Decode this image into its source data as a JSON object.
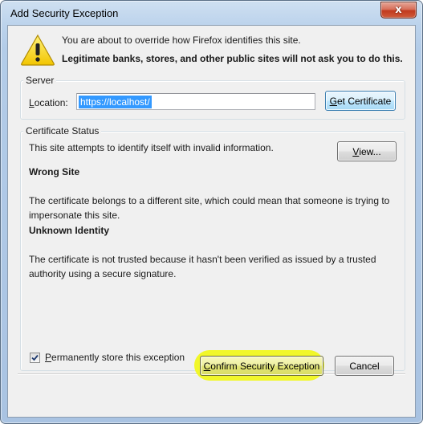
{
  "window": {
    "title": "Add Security Exception",
    "close_label": "x"
  },
  "warning": {
    "icon": "warning-icon",
    "line1": "You are about to override how Firefox identifies this site.",
    "line2": "Legitimate banks, stores, and other public sites will not ask you to do this."
  },
  "server": {
    "group_label": "Server",
    "location_label_accel": "L",
    "location_label_rest": "ocation:",
    "location_value": "https://localhost/",
    "get_certificate_accel": "G",
    "get_certificate_rest": "et Certificate"
  },
  "status": {
    "group_label": "Certificate Status",
    "intro": "This site attempts to identify itself with invalid information.",
    "view_accel": "V",
    "view_rest": "iew...",
    "heading1": "Wrong Site",
    "text1": "The certificate belongs to a different site, which could mean that someone is trying to impersonate this site.",
    "heading2": "Unknown Identity",
    "text2": "The certificate is not trusted because it hasn't been verified as issued by a trusted authority using a secure signature."
  },
  "permanent": {
    "checked": true,
    "label_accel": "P",
    "label_rest": "ermanently store this exception"
  },
  "buttons": {
    "confirm_accel": "C",
    "confirm_rest": "onfirm Security Exception",
    "cancel": "Cancel"
  },
  "colors": {
    "highlight": "#f1f72a",
    "selection": "#3399ff"
  }
}
